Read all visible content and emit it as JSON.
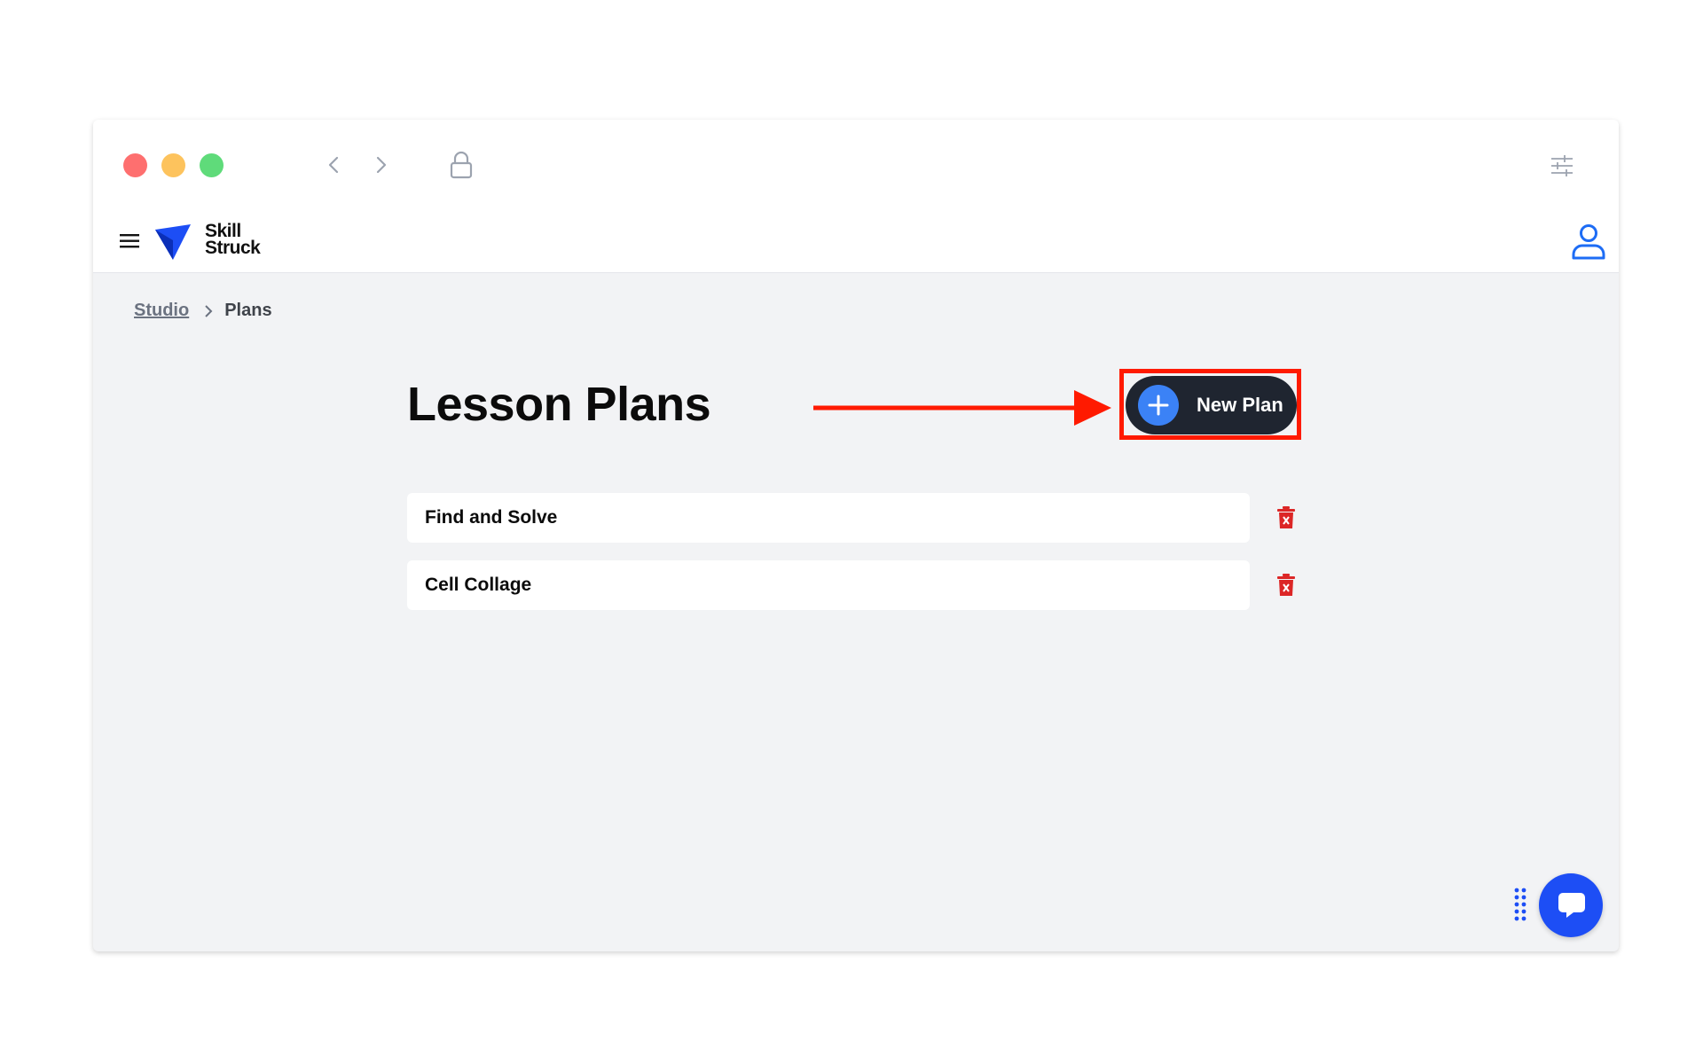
{
  "browser": {
    "traffic_colors": {
      "close": "#fe6f6f",
      "minimize": "#fdc35d",
      "maximize": "#5fdb7a"
    }
  },
  "app": {
    "logo_line1": "Skill",
    "logo_line2": "Struck",
    "brand_color": "#1d4ef5"
  },
  "breadcrumb": {
    "link": "Studio",
    "current": "Plans"
  },
  "page": {
    "title": "Lesson Plans",
    "new_plan_label": "New Plan",
    "annotation_color": "#ff1a00"
  },
  "plans": [
    {
      "name": "Find and Solve"
    },
    {
      "name": "Cell Collage"
    }
  ],
  "icons": {
    "back": "chevron-left-icon",
    "forward": "chevron-right-icon",
    "lock": "lock-icon",
    "settings": "sliders-icon",
    "menu": "hamburger-icon",
    "user": "user-icon",
    "plus": "plus-icon",
    "delete": "trash-icon",
    "chat": "chat-icon"
  }
}
